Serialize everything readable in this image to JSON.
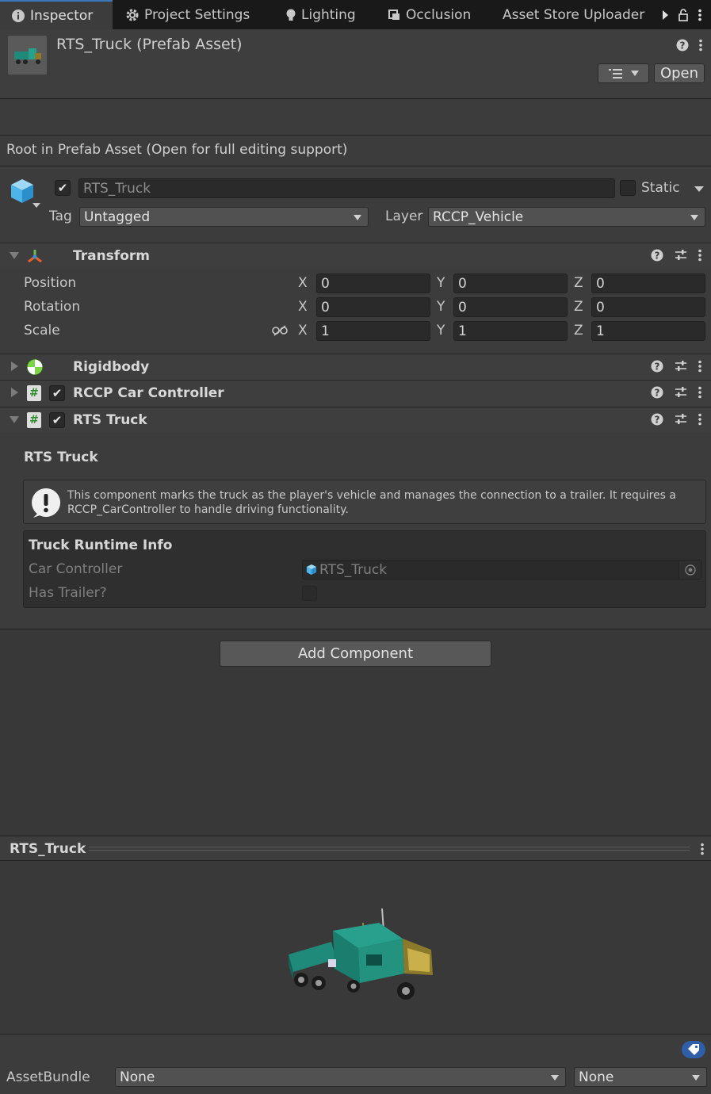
{
  "tabs": [
    {
      "label": "Inspector",
      "icon": "info-icon",
      "active": true
    },
    {
      "label": "Project Settings",
      "icon": "gear-icon"
    },
    {
      "label": "Lighting",
      "icon": "bulb-icon"
    },
    {
      "label": "Occlusion",
      "icon": "occlusion-icon"
    },
    {
      "label": "Asset Store Uploader",
      "icon": ""
    }
  ],
  "header": {
    "title": "RTS_Truck (Prefab Asset)",
    "open_label": "Open"
  },
  "prefab_notice": "Root in Prefab Asset (Open for full editing support)",
  "gameobject": {
    "name": "RTS_Truck",
    "active": true,
    "static_label": "Static",
    "tag_label": "Tag",
    "tag_value": "Untagged",
    "layer_label": "Layer",
    "layer_value": "RCCP_Vehicle"
  },
  "transform": {
    "title": "Transform",
    "position_label": "Position",
    "rotation_label": "Rotation",
    "scale_label": "Scale",
    "axis_x": "X",
    "axis_y": "Y",
    "axis_z": "Z",
    "position": {
      "x": "0",
      "y": "0",
      "z": "0"
    },
    "rotation": {
      "x": "0",
      "y": "0",
      "z": "0"
    },
    "scale": {
      "x": "1",
      "y": "1",
      "z": "1"
    }
  },
  "components": {
    "rigidbody": "Rigidbody",
    "car_controller": "RCCP Car Controller",
    "rts_truck": "RTS Truck"
  },
  "rts_truck": {
    "section_title": "RTS Truck",
    "help_text": "This component marks the truck as the player's vehicle and manages the connection to a trailer. It requires a RCCP_CarController to handle driving functionality.",
    "runtime_title": "Truck Runtime Info",
    "car_controller_label": "Car Controller",
    "car_controller_value": "RTS_Truck",
    "has_trailer_label": "Has Trailer?",
    "has_trailer": false
  },
  "add_component_label": "Add Component",
  "preview": {
    "title": "RTS_Truck"
  },
  "asset_bundle": {
    "label": "AssetBundle",
    "name_value": "None",
    "variant_value": "None"
  },
  "colors": {
    "accent": "#3a79bb",
    "truck": "#1f8a7a"
  }
}
